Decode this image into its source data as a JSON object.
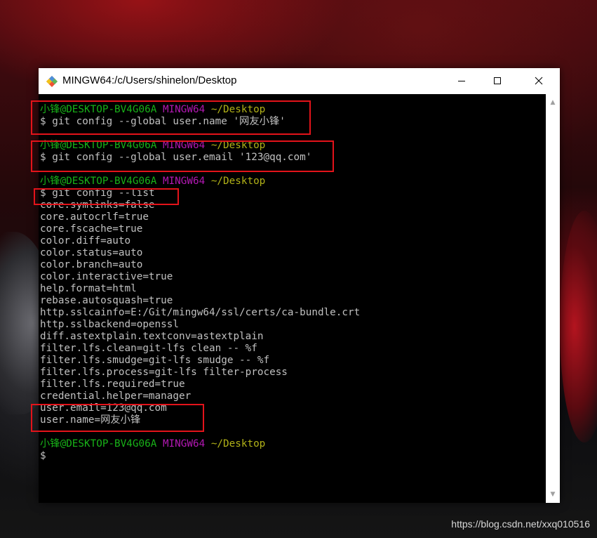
{
  "window": {
    "title": "MINGW64:/c/Users/shinelon/Desktop"
  },
  "prompt": {
    "user_host": "小锋@DESKTOP-BV4G06A",
    "system": "MINGW64",
    "path": "~/Desktop",
    "symbol": "$"
  },
  "commands": [
    "git config --global user.name '网友小锋'",
    "git config --global user.email '123@qq.com'",
    "git config --list"
  ],
  "config_output": [
    "core.symlinks=false",
    "core.autocrlf=true",
    "core.fscache=true",
    "color.diff=auto",
    "color.status=auto",
    "color.branch=auto",
    "color.interactive=true",
    "help.format=html",
    "rebase.autosquash=true",
    "http.sslcainfo=E:/Git/mingw64/ssl/certs/ca-bundle.crt",
    "http.sslbackend=openssl",
    "diff.astextplain.textconv=astextplain",
    "filter.lfs.clean=git-lfs clean -- %f",
    "filter.lfs.smudge=git-lfs smudge -- %f",
    "filter.lfs.process=git-lfs filter-process",
    "filter.lfs.required=true",
    "credential.helper=manager",
    "user.email=123@qq.com",
    "user.name=网友小锋"
  ],
  "watermark": "https://blog.csdn.net/xxq010516",
  "colors": {
    "prompt_user": "#18b218",
    "prompt_system": "#b218b2",
    "prompt_path": "#b2b218",
    "highlight_box": "#e3131a",
    "terminal_bg": "#000000",
    "terminal_fg": "#c0c0c0"
  }
}
